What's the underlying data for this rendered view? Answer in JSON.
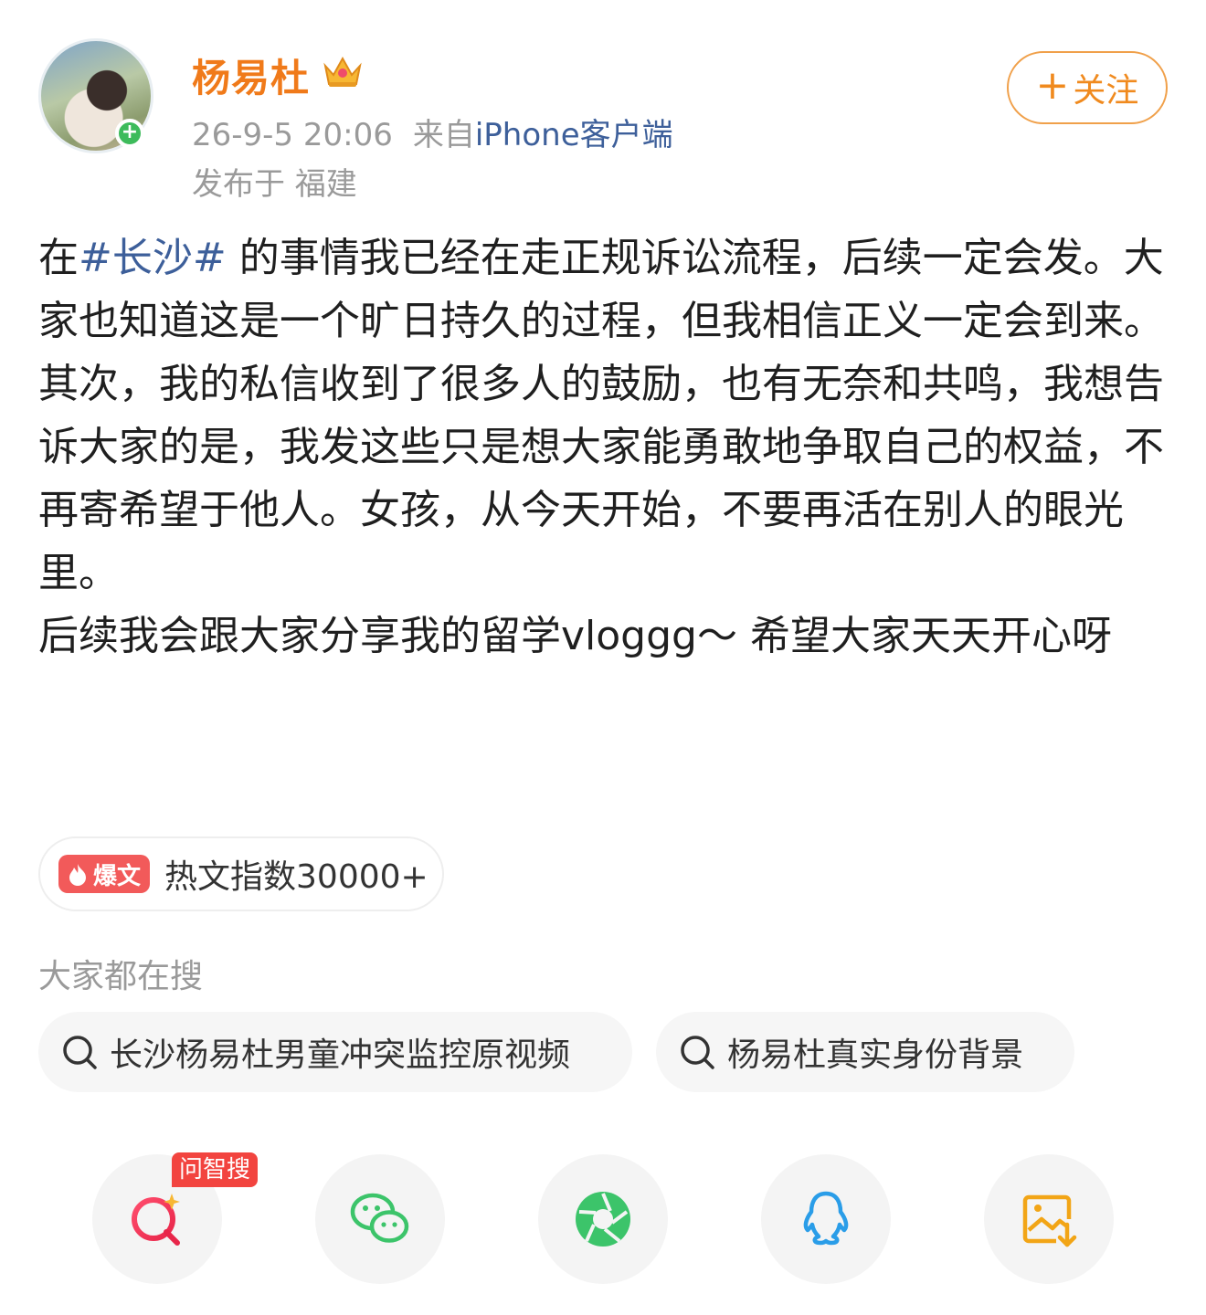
{
  "post": {
    "author": {
      "name": "杨易杜",
      "avatar_icon": "user-avatar-photo",
      "badge_icon": "crown-icon",
      "online_badge": "+"
    },
    "meta": {
      "time": "26-9-5 20:06",
      "source_prefix": "来自",
      "client": "iPhone客户端",
      "location": "发布于 福建"
    },
    "follow_button": {
      "plus": "+",
      "label": "关注"
    },
    "content": {
      "p1_prefix": "在",
      "topic": "#长沙#",
      "p1_rest": " 的事情我已经在走正规诉讼流程，后续一定会发。大家也知道这是一个旷日持久的过程，但我相信正义一定会到来。",
      "p2": "其次，我的私信收到了很多人的鼓励，也有无奈和共鸣，我想告诉大家的是，我发这些只是想大家能勇敢地争取自己的权益，不再寄希望于他人。女孩，从今天开始，不要再活在别人的眼光里。",
      "p3": "后续我会跟大家分享我的留学vloggg～ 希望大家天天开心呀"
    },
    "hot": {
      "tag": "爆文",
      "text": "热文指数30000+"
    },
    "search": {
      "title": "大家都在搜",
      "items": [
        "长沙杨易杜男童冲突监控原视频",
        "杨易杜真实身份背景"
      ]
    },
    "share": {
      "ai_badge": "问智搜",
      "buttons": [
        "ai-search-icon",
        "wechat-icon",
        "moments-icon",
        "qq-icon",
        "save-image-icon"
      ]
    },
    "colors": {
      "accent": "#f07a1a",
      "link": "#3d5f9a",
      "hot_red": "#f25a5a"
    }
  }
}
